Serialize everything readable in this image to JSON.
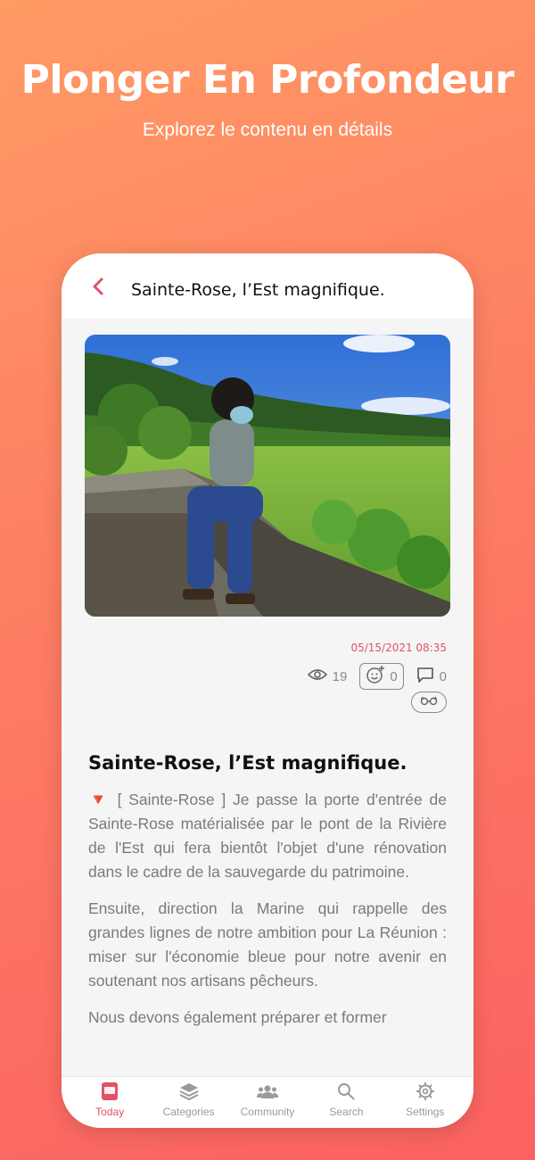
{
  "promo": {
    "title": "Plonger En Profondeur",
    "subtitle": "Explorez le contenu en détails"
  },
  "nav": {
    "back_icon": "chevron-left-icon",
    "title": "Sainte-Rose, l’Est magnifique."
  },
  "article": {
    "date": "05/15/2021 08:35",
    "views": "19",
    "reactions": "0",
    "comments": "0",
    "title": "Sainte-Rose, l’Est magnifique.",
    "paragraphs": [
      "🔻 [ Sainte-Rose ] Je passe la porte d'entrée de Sainte-Rose matérialisée par le pont de la Rivière de l'Est qui fera bientôt l'objet d'une rénovation dans le cadre de la sauvegarde du patrimoine.",
      "Ensuite, direction la Marine qui rappelle des grandes lignes de notre ambition pour La Réunion : miser sur l'économie bleue pour notre avenir en soutenant nos artisans pêcheurs.",
      "Nous devons également préparer et former"
    ]
  },
  "tabs": [
    {
      "label": "Today",
      "icon": "today-icon",
      "active": true
    },
    {
      "label": "Categories",
      "icon": "layers-icon",
      "active": false
    },
    {
      "label": "Community",
      "icon": "people-icon",
      "active": false
    },
    {
      "label": "Search",
      "icon": "search-icon",
      "active": false
    },
    {
      "label": "Settings",
      "icon": "gear-icon",
      "active": false
    }
  ],
  "colors": {
    "accent": "#e2516a",
    "background_start": "#ff9a64",
    "background_end": "#fc6262"
  }
}
